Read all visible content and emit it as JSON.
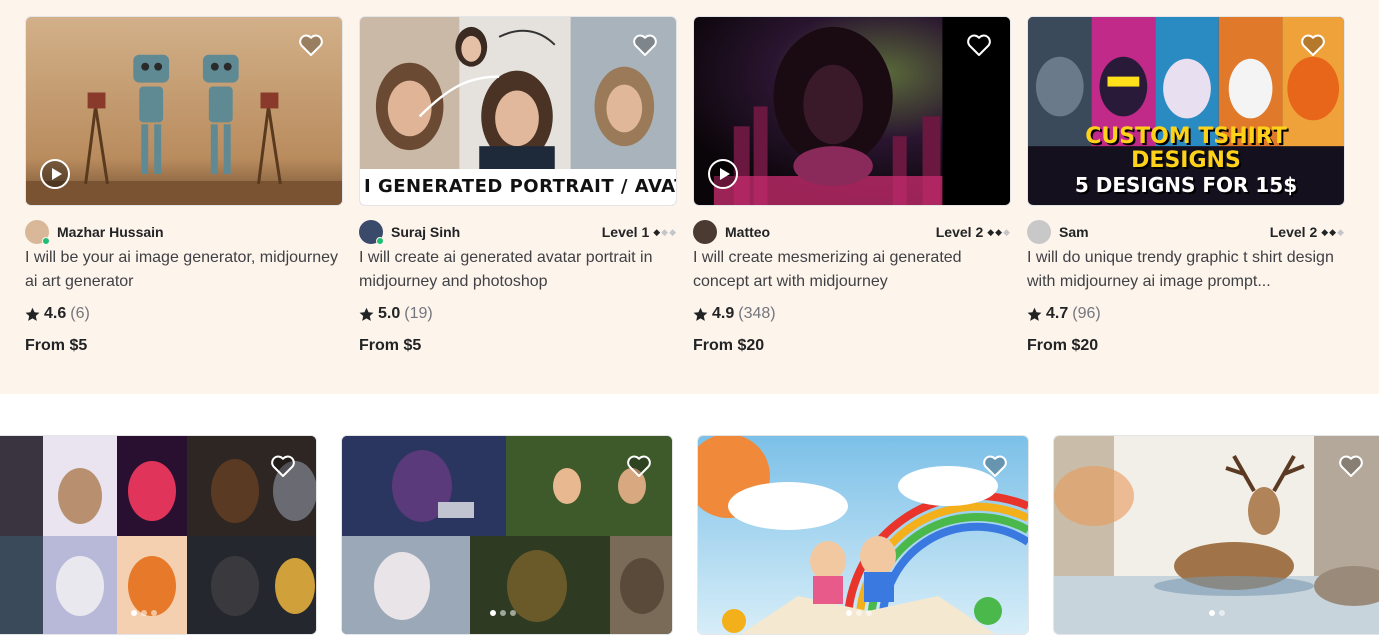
{
  "gigs": [
    {
      "seller": "Mazhar Hussain",
      "level": "",
      "level_diamonds": 0,
      "online": true,
      "title": "I will be your ai image generator, midjourney ai art generator",
      "rating": "4.6",
      "reviews": "(6)",
      "price": "From $5",
      "has_video": true,
      "thumb_colors": [
        "#c9a578",
        "#7a5a3a"
      ]
    },
    {
      "seller": "Suraj Sinh",
      "level": "Level 1",
      "level_diamonds": 1,
      "online": true,
      "title": "I will create ai generated avatar portrait in midjourney and photoshop",
      "rating": "5.0",
      "reviews": "(19)",
      "price": "From $5",
      "has_video": false,
      "banner": "I GENERATED PORTRAIT / AVATA",
      "thumb_colors": [
        "#d8d0c6",
        "#6a4d3a"
      ]
    },
    {
      "seller": "Matteo",
      "level": "Level 2",
      "level_diamonds": 2,
      "online": false,
      "title": "I will create mesmerizing ai generated concept art with midjourney",
      "rating": "4.9",
      "reviews": "(348)",
      "price": "From $20",
      "has_video": true,
      "thumb_colors": [
        "#3a0f2a",
        "#d63a7a"
      ]
    },
    {
      "seller": "Sam",
      "level": "Level 2",
      "level_diamonds": 2,
      "online": false,
      "title": "I will do unique trendy graphic t shirt design with midjourney ai image prompt...",
      "rating": "4.7",
      "reviews": "(96)",
      "price": "From $20",
      "has_video": false,
      "overlay_line1": "CUSTOM TSHIRT DESIGNS",
      "overlay_line2": "5 DESIGNS FOR 15$",
      "thumb_colors": [
        "#1a1230",
        "#e0347a"
      ]
    }
  ],
  "row2": [
    {
      "name": "pets-collage-card",
      "dots": 3,
      "active_dot": 0,
      "colors": [
        "#2b2f3a",
        "#e06a2a"
      ]
    },
    {
      "name": "anime-characters-card",
      "dots": 3,
      "active_dot": 0,
      "colors": [
        "#23304a",
        "#6a8a3a"
      ]
    },
    {
      "name": "storybook-kids-card",
      "dots": 3,
      "active_dot": 0,
      "colors": [
        "#8ac8e8",
        "#f2b24a"
      ]
    },
    {
      "name": "watercolor-deer-card",
      "dots": 2,
      "active_dot": 0,
      "colors": [
        "#f1ede6",
        "#a07a52"
      ]
    }
  ],
  "icons": {
    "heart": "heart-icon",
    "star": "star-icon",
    "play": "play-icon",
    "diamond": "diamond-icon"
  },
  "colors": {
    "band": "#fdf4ec",
    "online": "#1dbf73",
    "text": "#404145",
    "strong": "#222325",
    "muted": "#74767e"
  }
}
